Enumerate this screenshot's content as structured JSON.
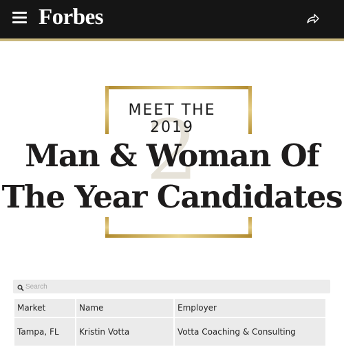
{
  "header": {
    "brand": "Forbes",
    "menu_icon": "hamburger-menu-icon",
    "share_icon": "share-arrow-icon",
    "background": "#151515",
    "accent": "#c9b77d"
  },
  "hero": {
    "kicker": "MEET THE 2019",
    "headline_line1": "Man & Woman Of",
    "headline_line2": "The Year Candidates",
    "watermark": "2",
    "frame_color": "#c9a84f"
  },
  "search": {
    "placeholder": "Search"
  },
  "table": {
    "columns": [
      "Market",
      "Name",
      "Employer"
    ],
    "rows": [
      {
        "market": "Tampa, FL",
        "name": "Kristin Votta",
        "employer": "Votta Coaching & Consulting"
      }
    ]
  }
}
